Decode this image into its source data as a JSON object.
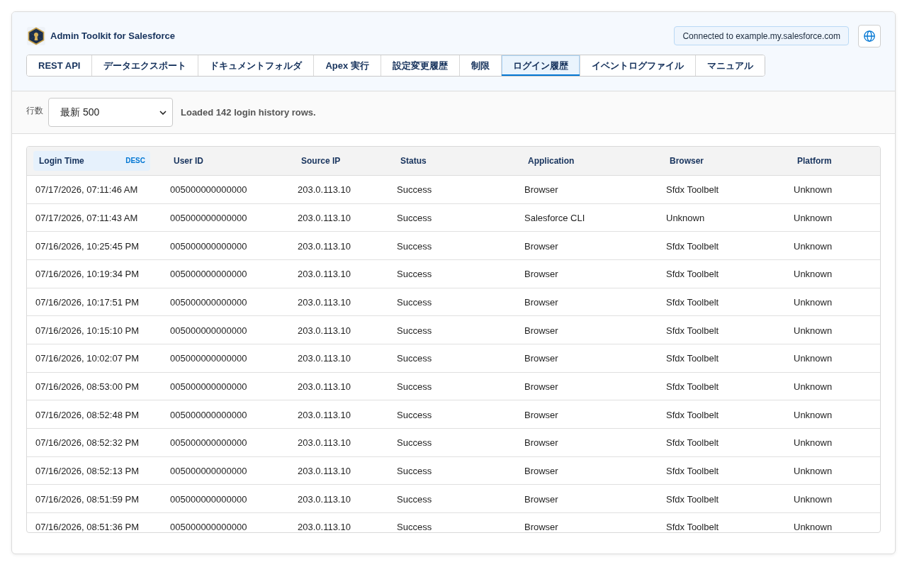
{
  "header": {
    "title": "Admin Toolkit for Salesforce",
    "connection": "Connected to example.my.salesforce.com"
  },
  "tabs": [
    {
      "label": "REST API",
      "selected": false
    },
    {
      "label": "データエクスポート",
      "selected": false
    },
    {
      "label": "ドキュメントフォルダ",
      "selected": false
    },
    {
      "label": "Apex 実行",
      "selected": false
    },
    {
      "label": "設定変更履歴",
      "selected": false
    },
    {
      "label": "制限",
      "selected": false
    },
    {
      "label": "ログイン履歴",
      "selected": true
    },
    {
      "label": "イベントログファイル",
      "selected": false
    },
    {
      "label": "マニュアル",
      "selected": false
    }
  ],
  "toolbar": {
    "label": "行数",
    "select_value": "最新 500",
    "status": "Loaded 142 login history rows."
  },
  "table": {
    "columns": [
      {
        "label": "Login Time",
        "sort_direction": "DESC"
      },
      {
        "label": "User ID"
      },
      {
        "label": "Source IP"
      },
      {
        "label": "Status"
      },
      {
        "label": "Application"
      },
      {
        "label": "Browser"
      },
      {
        "label": "Platform"
      }
    ],
    "rows": [
      [
        "07/17/2026, 07:11:46 AM",
        "005000000000000",
        "203.0.113.10",
        "Success",
        "Browser",
        "Sfdx Toolbelt",
        "Unknown"
      ],
      [
        "07/17/2026, 07:11:43 AM",
        "005000000000000",
        "203.0.113.10",
        "Success",
        "Salesforce CLI",
        "Unknown",
        "Unknown"
      ],
      [
        "07/16/2026, 10:25:45 PM",
        "005000000000000",
        "203.0.113.10",
        "Success",
        "Browser",
        "Sfdx Toolbelt",
        "Unknown"
      ],
      [
        "07/16/2026, 10:19:34 PM",
        "005000000000000",
        "203.0.113.10",
        "Success",
        "Browser",
        "Sfdx Toolbelt",
        "Unknown"
      ],
      [
        "07/16/2026, 10:17:51 PM",
        "005000000000000",
        "203.0.113.10",
        "Success",
        "Browser",
        "Sfdx Toolbelt",
        "Unknown"
      ],
      [
        "07/16/2026, 10:15:10 PM",
        "005000000000000",
        "203.0.113.10",
        "Success",
        "Browser",
        "Sfdx Toolbelt",
        "Unknown"
      ],
      [
        "07/16/2026, 10:02:07 PM",
        "005000000000000",
        "203.0.113.10",
        "Success",
        "Browser",
        "Sfdx Toolbelt",
        "Unknown"
      ],
      [
        "07/16/2026, 08:53:00 PM",
        "005000000000000",
        "203.0.113.10",
        "Success",
        "Browser",
        "Sfdx Toolbelt",
        "Unknown"
      ],
      [
        "07/16/2026, 08:52:48 PM",
        "005000000000000",
        "203.0.113.10",
        "Success",
        "Browser",
        "Sfdx Toolbelt",
        "Unknown"
      ],
      [
        "07/16/2026, 08:52:32 PM",
        "005000000000000",
        "203.0.113.10",
        "Success",
        "Browser",
        "Sfdx Toolbelt",
        "Unknown"
      ],
      [
        "07/16/2026, 08:52:13 PM",
        "005000000000000",
        "203.0.113.10",
        "Success",
        "Browser",
        "Sfdx Toolbelt",
        "Unknown"
      ],
      [
        "07/16/2026, 08:51:59 PM",
        "005000000000000",
        "203.0.113.10",
        "Success",
        "Browser",
        "Sfdx Toolbelt",
        "Unknown"
      ],
      [
        "07/16/2026, 08:51:36 PM",
        "005000000000000",
        "203.0.113.10",
        "Success",
        "Browser",
        "Sfdx Toolbelt",
        "Unknown"
      ]
    ]
  }
}
